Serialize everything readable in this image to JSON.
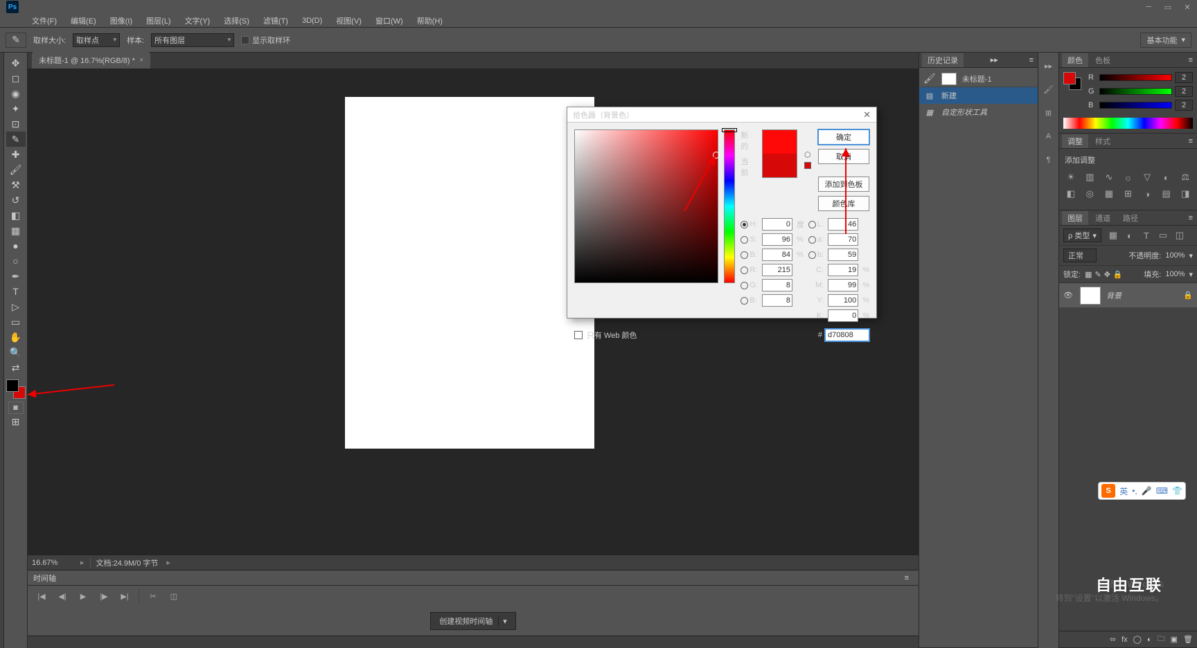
{
  "menu": {
    "file": "文件(F)",
    "edit": "编辑(E)",
    "image": "图像(I)",
    "layer": "图层(L)",
    "type": "文字(Y)",
    "select": "选择(S)",
    "filter": "滤镜(T)",
    "threeD": "3D(D)",
    "view": "视图(V)",
    "window": "窗口(W)",
    "help": "帮助(H)"
  },
  "options": {
    "sample_size_label": "取样大小:",
    "sample_size_value": "取样点",
    "sample_label": "样本:",
    "sample_value": "所有图层",
    "show_ring": "显示取样环",
    "workspace": "基本功能"
  },
  "doc": {
    "tab_title": "未标题-1 @ 16.7%(RGB/8) *",
    "zoom": "16.67%",
    "doc_info_label": "文档:",
    "doc_info": "24.9M/0 字节"
  },
  "timeline": {
    "title": "时间轴",
    "create_btn": "创建视频时间轴"
  },
  "history": {
    "tab": "历史记录",
    "doc_name": "未标题-1",
    "item_new": "新建",
    "item_tool": "自定形状工具"
  },
  "colorPanel": {
    "tab_color": "颜色",
    "tab_swatch": "色板",
    "r": "R",
    "g": "G",
    "b": "B",
    "r_val": "2",
    "g_val": "2",
    "b_val": "2"
  },
  "adjust": {
    "tab_adjust": "调整",
    "tab_style": "样式",
    "add_label": "添加调整"
  },
  "layers": {
    "tab_layers": "图层",
    "tab_channels": "通道",
    "tab_paths": "路径",
    "kind": "ρ 类型",
    "blend": "正常",
    "opacity_label": "不透明度:",
    "opacity": "100%",
    "lock_label": "锁定:",
    "fill_label": "填充:",
    "fill": "100%",
    "bg_layer": "背景"
  },
  "colorPicker": {
    "title": "拾色器（背景色）",
    "new_label": "新的",
    "current_label": "当前",
    "ok": "确定",
    "cancel": "取消",
    "add_swatch": "添加到色板",
    "color_lib": "颜色库",
    "web_only": "只有 Web 颜色",
    "H": "H:",
    "S": "S:",
    "B": "B:",
    "L": "L:",
    "a": "a:",
    "b2": "b:",
    "R": "R:",
    "G": "G:",
    "B2": "B:",
    "C": "C:",
    "M": "M:",
    "Y": "Y:",
    "K": "K:",
    "h_val": "0",
    "s_val": "96",
    "b_val": "84",
    "l_val": "46",
    "a_val": "70",
    "b2_val": "59",
    "r_val": "215",
    "g_val": "8",
    "bb_val": "8",
    "c_val": "19",
    "m_val": "99",
    "y_val": "100",
    "k_val": "0",
    "deg": "度",
    "pct": "%",
    "hex_label": "#",
    "hex_val": "d70808"
  },
  "watermark": {
    "line1": "激活 Windows",
    "line2": "转到\"设置\"以激活 Windows。",
    "logo": "自由互联"
  },
  "ime": {
    "lang": "英"
  }
}
